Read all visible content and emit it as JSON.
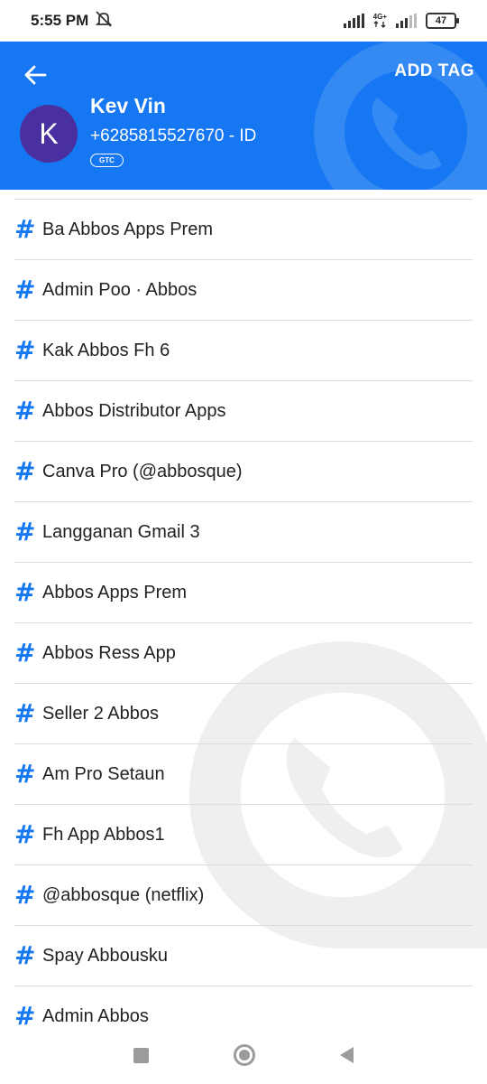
{
  "status_bar": {
    "time": "5:55 PM",
    "network": "4G+",
    "battery": "47",
    "icons": [
      "muted-notification-icon",
      "signal-icon",
      "mobile-data-icon",
      "battery-icon"
    ]
  },
  "header": {
    "add_tag_label": "ADD TAG",
    "avatar_letter": "K",
    "name": "Kev Vin",
    "phone": "+6285815527670 - ID",
    "badge": "GTC",
    "colors": {
      "background": "#1577f2",
      "avatar": "#4a2fa0"
    }
  },
  "tags": [
    {
      "label": "Ba Abbos Apps Prem"
    },
    {
      "label": "Admin Poo · Abbos"
    },
    {
      "label": "Kak Abbos Fh 6"
    },
    {
      "label": "Abbos Distributor Apps"
    },
    {
      "label": "Canva Pro (@abbosque)"
    },
    {
      "label": "Langganan Gmail 3"
    },
    {
      "label": "Abbos Apps Prem"
    },
    {
      "label": "Abbos Ress App"
    },
    {
      "label": "Seller 2 Abbos"
    },
    {
      "label": "Am Pro Setaun"
    },
    {
      "label": "Fh App Abbos1"
    },
    {
      "label": "@abbosque (netflix)"
    },
    {
      "label": "Spay Abbousku"
    },
    {
      "label": "Admin Abbos"
    }
  ],
  "tag_icon": {
    "symbol": "#",
    "color": "#1577f2"
  },
  "nav": {
    "icons": [
      "recents-square-icon",
      "home-circle-icon",
      "back-triangle-icon"
    ]
  }
}
